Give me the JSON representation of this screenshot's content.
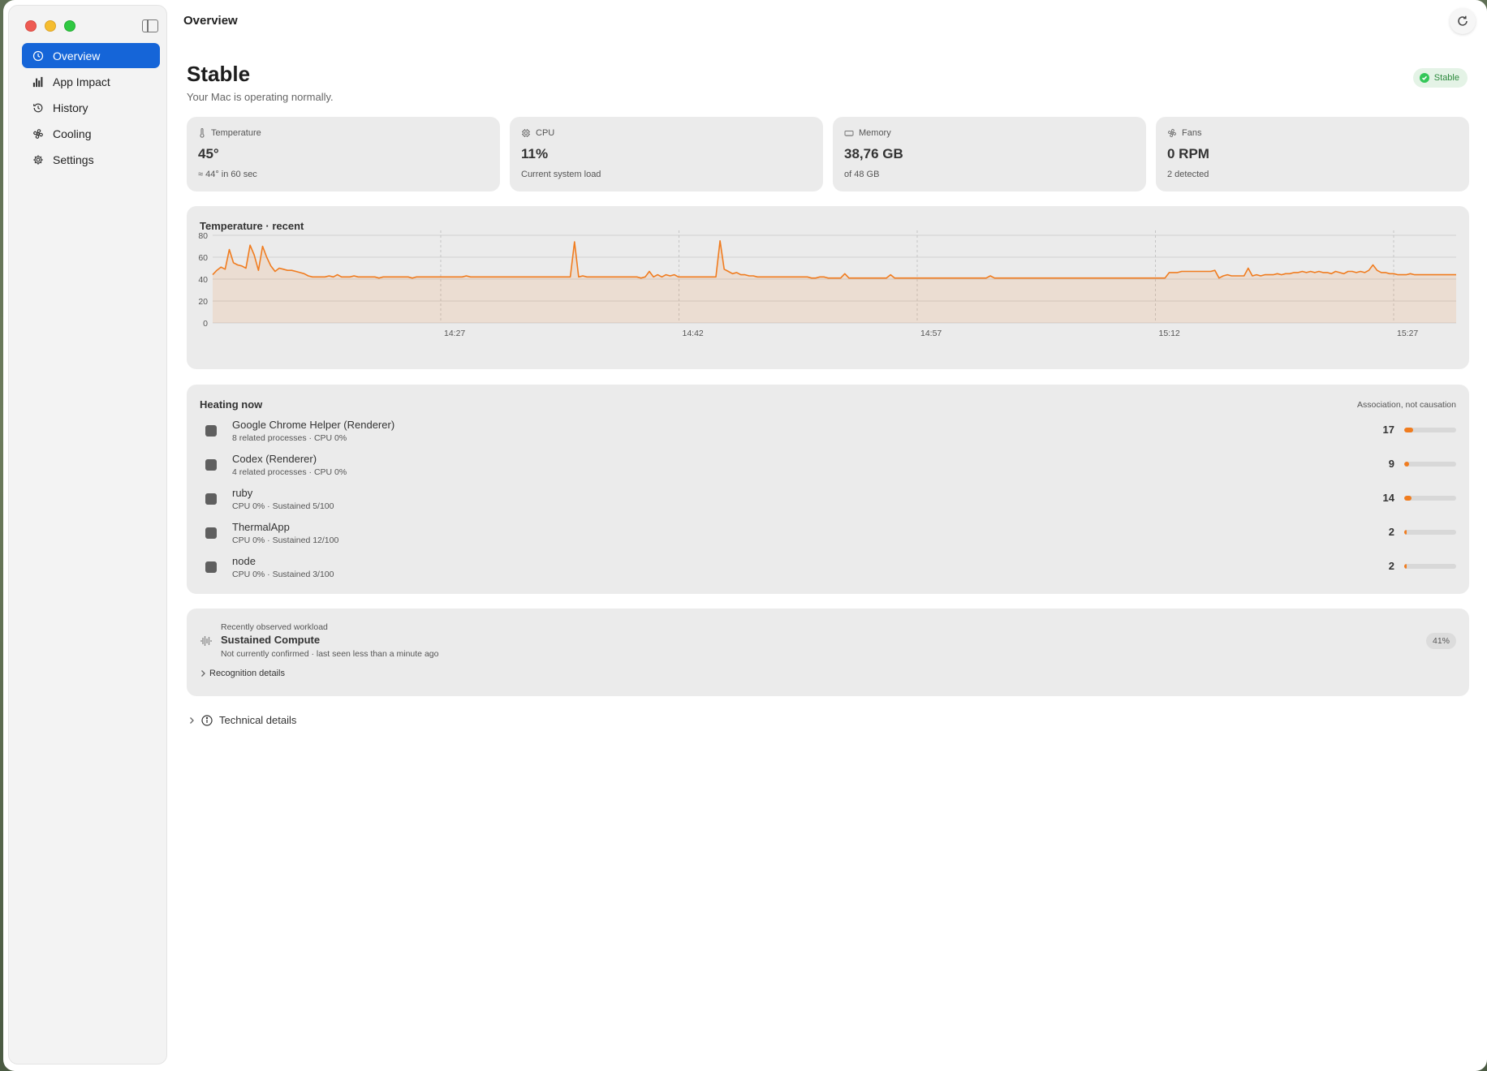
{
  "window": {
    "title": "Overview"
  },
  "sidebar": {
    "items": [
      {
        "label": "Overview",
        "icon": "overview-icon",
        "active": true
      },
      {
        "label": "App Impact",
        "icon": "bar-chart-icon",
        "active": false
      },
      {
        "label": "History",
        "icon": "history-icon",
        "active": false
      },
      {
        "label": "Cooling",
        "icon": "fan-icon",
        "active": false
      },
      {
        "label": "Settings",
        "icon": "gear-icon",
        "active": false
      }
    ]
  },
  "header": {
    "title": "Stable",
    "subtitle": "Your Mac is operating normally.",
    "status_badge": "Stable"
  },
  "cards": [
    {
      "label": "Temperature",
      "value": "45°",
      "sub": "≈ 44° in 60 sec",
      "icon": "thermometer-icon"
    },
    {
      "label": "CPU",
      "value": "11%",
      "sub": "Current system load",
      "icon": "cpu-icon"
    },
    {
      "label": "Memory",
      "value": "38,76 GB",
      "sub": "of 48 GB",
      "icon": "memory-icon"
    },
    {
      "label": "Fans",
      "value": "0 RPM",
      "sub": "2 detected",
      "icon": "fan-icon"
    }
  ],
  "chart_data": {
    "type": "area",
    "title": "Temperature · recent",
    "y_ticks": [
      "0",
      "20",
      "40",
      "60",
      "80"
    ],
    "ylim": [
      0,
      80
    ],
    "x_ticks": [
      "14:27",
      "14:42",
      "14:57",
      "15:12",
      "15:27"
    ],
    "grid": true,
    "color": "#f07c1f",
    "values": [
      44,
      48,
      51,
      49,
      67,
      55,
      53,
      52,
      50,
      71,
      62,
      48,
      70,
      60,
      52,
      47,
      50,
      49,
      48,
      48,
      47,
      46,
      45,
      43,
      42,
      42,
      42,
      42,
      43,
      42,
      44,
      42,
      42,
      42,
      43,
      42,
      42,
      42,
      42,
      42,
      41,
      42,
      42,
      42,
      42,
      42,
      42,
      42,
      41,
      42,
      42,
      42,
      42,
      42,
      42,
      42,
      42,
      42,
      42,
      42,
      42,
      43,
      42,
      42,
      42,
      42,
      42,
      42,
      42,
      42,
      42,
      42,
      42,
      42,
      42,
      42,
      42,
      42,
      42,
      42,
      42,
      42,
      42,
      42,
      42,
      42,
      42,
      74,
      42,
      43,
      42,
      42,
      42,
      42,
      42,
      42,
      42,
      42,
      42,
      42,
      42,
      42,
      42,
      41,
      42,
      47,
      42,
      44,
      42,
      44,
      43,
      44,
      42,
      42,
      42,
      42,
      42,
      42,
      42,
      42,
      42,
      42,
      75,
      49,
      47,
      45,
      46,
      44,
      44,
      43,
      43,
      42,
      42,
      42,
      42,
      42,
      42,
      42,
      42,
      42,
      42,
      42,
      42,
      42,
      41,
      41,
      42,
      42,
      41,
      41,
      41,
      41,
      45,
      41,
      41,
      41,
      41,
      41,
      41,
      41,
      41,
      41,
      41,
      44,
      41,
      41,
      41,
      41,
      41,
      41,
      41,
      41,
      41,
      41,
      41,
      41,
      41,
      41,
      41,
      41,
      41,
      41,
      41,
      41,
      41,
      41,
      41,
      43,
      41,
      41,
      41,
      41,
      41,
      41,
      41,
      41,
      41,
      41,
      41,
      41,
      41,
      41,
      41,
      41,
      41,
      41,
      41,
      41,
      41,
      41,
      41,
      41,
      41,
      41,
      41,
      41,
      41,
      41,
      41,
      41,
      41,
      41,
      41,
      41,
      41,
      41,
      41,
      41,
      41,
      41,
      46,
      46,
      46,
      47,
      47,
      47,
      47,
      47,
      47,
      47,
      47,
      48,
      41,
      43,
      44,
      43,
      43,
      43,
      43,
      50,
      43,
      44,
      43,
      44,
      44,
      44,
      45,
      44,
      45,
      45,
      46,
      46,
      47,
      46,
      47,
      46,
      47,
      46,
      46,
      45,
      47,
      46,
      45,
      47,
      47,
      46,
      47,
      46,
      48,
      53,
      48,
      46,
      46,
      45,
      45,
      44,
      44,
      44,
      45,
      44,
      44,
      44,
      44,
      44,
      44,
      44,
      44,
      44,
      44,
      44
    ]
  },
  "heating": {
    "title": "Heating now",
    "note": "Association, not causation",
    "rows": [
      {
        "name": "Google Chrome Helper (Renderer)",
        "meta": "8 related processes · CPU 0%",
        "score": "17",
        "fraction": 0.17
      },
      {
        "name": "Codex (Renderer)",
        "meta": "4 related processes · CPU 0%",
        "score": "9",
        "fraction": 0.09
      },
      {
        "name": "ruby",
        "meta": "CPU 0% · Sustained 5/100",
        "score": "14",
        "fraction": 0.14
      },
      {
        "name": "ThermalApp",
        "meta": "CPU 0% · Sustained 12/100",
        "score": "2",
        "fraction": 0.02
      },
      {
        "name": "node",
        "meta": "CPU 0% · Sustained 3/100",
        "score": "2",
        "fraction": 0.02
      }
    ]
  },
  "workload": {
    "kicker": "Recently observed workload",
    "title": "Sustained Compute",
    "sub": "Not currently confirmed · last seen less than a minute ago",
    "percent": "41%",
    "details_label": "Recognition details"
  },
  "technical": {
    "label": "Technical details"
  }
}
